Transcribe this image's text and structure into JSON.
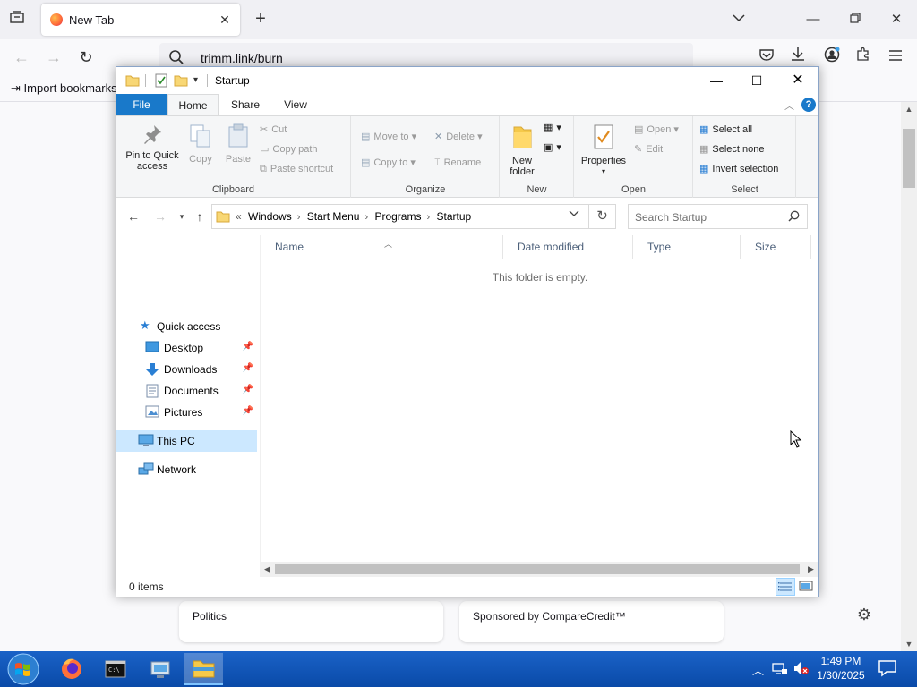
{
  "firefox": {
    "tab_title": "New Tab",
    "url": "trimm.link/burn",
    "import_bookmarks": "Import bookmarks...",
    "cards": [
      {
        "label": "Politics"
      },
      {
        "label": "Sponsored by CompareCredit™"
      }
    ]
  },
  "explorer": {
    "title": "Startup",
    "tabs": {
      "file": "File",
      "home": "Home",
      "share": "Share",
      "view": "View"
    },
    "ribbon": {
      "clipboard": {
        "label": "Clipboard",
        "pin": "Pin to Quick access",
        "copy": "Copy",
        "paste": "Paste",
        "cut": "Cut",
        "copy_path": "Copy path",
        "paste_shortcut": "Paste shortcut"
      },
      "organize": {
        "label": "Organize",
        "move_to": "Move to",
        "copy_to": "Copy to",
        "delete": "Delete",
        "rename": "Rename"
      },
      "new": {
        "label": "New",
        "new_folder": "New folder"
      },
      "open": {
        "label": "Open",
        "properties": "Properties",
        "open": "Open",
        "edit": "Edit"
      },
      "select": {
        "label": "Select",
        "select_all": "Select all",
        "select_none": "Select none",
        "invert": "Invert selection"
      }
    },
    "breadcrumb": [
      "Windows",
      "Start Menu",
      "Programs",
      "Startup"
    ],
    "breadcrumb_overflow": "«",
    "search_placeholder": "Search Startup",
    "nav": {
      "quick_access": "Quick access",
      "desktop": "Desktop",
      "downloads": "Downloads",
      "documents": "Documents",
      "pictures": "Pictures",
      "this_pc": "This PC",
      "network": "Network"
    },
    "columns": {
      "name": "Name",
      "date": "Date modified",
      "type": "Type",
      "size": "Size"
    },
    "empty_message": "This folder is empty.",
    "status": "0 items"
  },
  "taskbar": {
    "time": "1:49 PM",
    "date": "1/30/2025"
  }
}
